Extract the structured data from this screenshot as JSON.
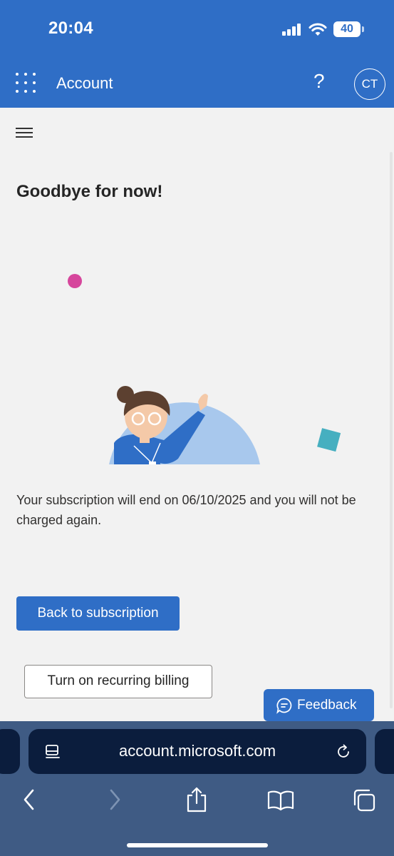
{
  "status_bar": {
    "time": "20:04",
    "battery": "40"
  },
  "header": {
    "app_title": "Account",
    "help_label": "?",
    "avatar_initials": "CT"
  },
  "main": {
    "heading": "Goodbye for now!",
    "message": "Your subscription will end on 06/10/2025 and you will not be charged again.",
    "back_button": "Back to subscription",
    "recurring_button": "Turn on recurring billing",
    "feedback_button": "Feedback"
  },
  "browser": {
    "url": "account.microsoft.com"
  },
  "colors": {
    "brand_blue": "#2f6ec6",
    "page_background": "#f2f2f2",
    "safari_toolbar": "#3f5b84"
  },
  "icons": [
    "app-launcher-icon",
    "help-icon",
    "hamburger-menu-icon",
    "feedback-chat-icon",
    "page-settings-icon",
    "reload-icon",
    "back-icon",
    "forward-icon",
    "share-icon",
    "bookmarks-icon",
    "tabs-icon"
  ]
}
